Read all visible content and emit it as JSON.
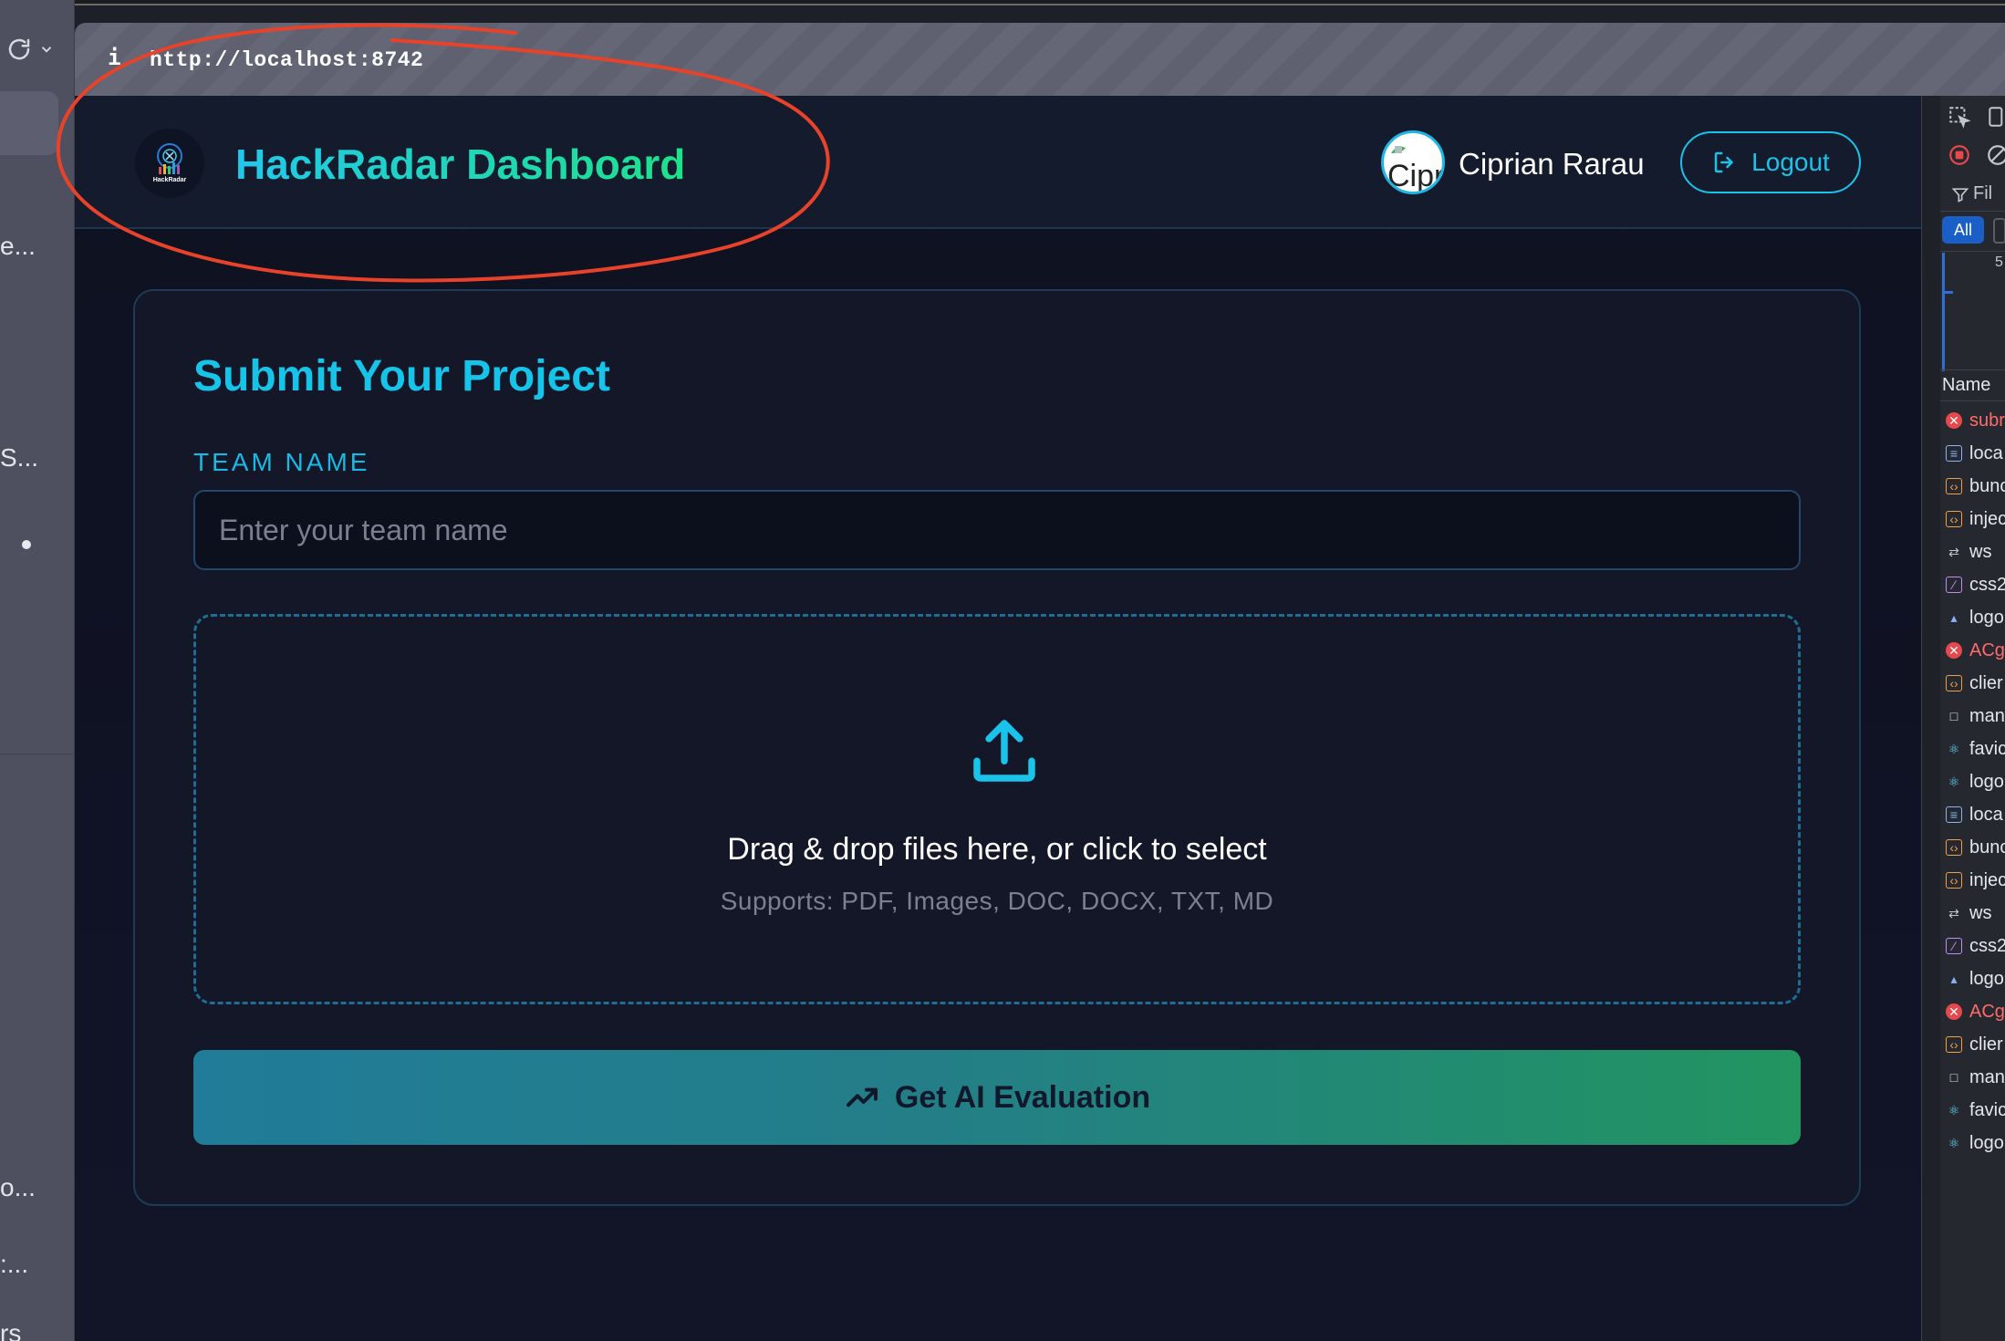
{
  "browser": {
    "url": "http://localhost:8742",
    "info_icon": "i",
    "sidebar_fragments": [
      "e...",
      "S...",
      "o...",
      ":...",
      "rs"
    ]
  },
  "header": {
    "app_title": "HackRadar Dashboard",
    "logo_text": "HackRadar",
    "user_name": "Ciprian Rarau",
    "avatar_text": "Cipr",
    "logout_label": "Logout"
  },
  "form": {
    "title": "Submit Your Project",
    "team_label": "TEAM NAME",
    "team_placeholder": "Enter your team name",
    "dropzone_text": "Drag & drop files here, or click to select",
    "dropzone_sub": "Supports: PDF, Images, DOC, DOCX, TXT, MD",
    "submit_label": "Get AI Evaluation"
  },
  "devtools": {
    "filter_label": "Fil",
    "all_label": "All",
    "timeline_tick": "5",
    "column_name": "Name",
    "requests": [
      {
        "name": "subr",
        "kind": "error"
      },
      {
        "name": "loca",
        "kind": "doc"
      },
      {
        "name": "bunc",
        "kind": "script"
      },
      {
        "name": "injec",
        "kind": "script"
      },
      {
        "name": "ws",
        "kind": "ws"
      },
      {
        "name": "css2",
        "kind": "css"
      },
      {
        "name": "logo",
        "kind": "img"
      },
      {
        "name": "ACg",
        "kind": "error"
      },
      {
        "name": "clier",
        "kind": "script"
      },
      {
        "name": "man",
        "kind": "file"
      },
      {
        "name": "favic",
        "kind": "react"
      },
      {
        "name": "logo",
        "kind": "react"
      },
      {
        "name": "loca",
        "kind": "doc"
      },
      {
        "name": "bunc",
        "kind": "script"
      },
      {
        "name": "injec",
        "kind": "script"
      },
      {
        "name": "ws",
        "kind": "ws"
      },
      {
        "name": "css2",
        "kind": "css"
      },
      {
        "name": "logo",
        "kind": "img"
      },
      {
        "name": "ACg",
        "kind": "error"
      },
      {
        "name": "clier",
        "kind": "script"
      },
      {
        "name": "man",
        "kind": "file"
      },
      {
        "name": "favic",
        "kind": "react"
      },
      {
        "name": "logo",
        "kind": "react"
      }
    ]
  },
  "colors": {
    "accent": "#19c3ea",
    "title_gradient_start": "#22c8ea",
    "title_gradient_end": "#1de28b",
    "button_gradient_start": "#207c98",
    "button_gradient_end": "#229560",
    "annotation": "#e8432a",
    "background": "#0e1120"
  }
}
